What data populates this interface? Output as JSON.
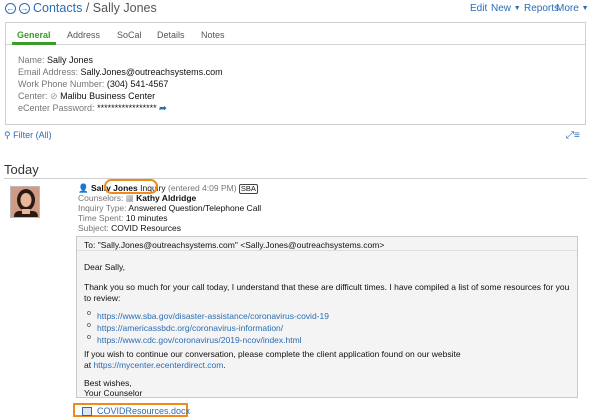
{
  "header": {
    "breadcrumb_root": "Contacts",
    "breadcrumb_sep": "/",
    "breadcrumb_current": "Sally Jones",
    "menu": {
      "edit": "Edit",
      "new": "New",
      "reports": "Reports",
      "more": "More"
    }
  },
  "tabs": [
    "General",
    "Address",
    "SoCal",
    "Details",
    "Notes"
  ],
  "contact": {
    "name_label": "Name:",
    "name": "Sally Jones",
    "email_label": "Email Address:",
    "email": "Sally.Jones@outreachsystems.com",
    "phone_label": "Work Phone Number:",
    "phone": "(304) 541-4567",
    "center_label": "Center:",
    "center": "Malibu Business Center",
    "password_label": "eCenter Password:",
    "password": "*****************"
  },
  "filter": {
    "label": "Filter (All)"
  },
  "section": {
    "title": "Today"
  },
  "activity": {
    "contact_name": "Sally Jones",
    "type_tag": "Inquiry",
    "entered": "(entered 4:09 PM)",
    "badge": "SBA",
    "counselors_label": "Counselors:",
    "counselor": "Kathy Aldridge",
    "inquiry_type_label": "Inquiry Type:",
    "inquiry_type": "Answered Question/Telephone Call",
    "time_label": "Time Spent:",
    "time": "10 minutes",
    "subject_label": "Subject:",
    "subject": "COVID Resources"
  },
  "email": {
    "to": "To: \"Sally.Jones@outreachsystems.com\" <Sally.Jones@outreachsystems.com>",
    "greeting": "Dear Sally,",
    "body_1": "Thank you so much for your call today, I understand that these are difficult times.  I have compiled a list of some resources for you",
    "body_2": "to review:",
    "links": [
      "https://www.sba.gov/disaster-assistance/coronavirus-covid-19",
      "https://americassbdc.org/coronavirus-information/",
      "https://www.cdc.gov/coronavirus/2019-ncov/index.html"
    ],
    "continue_1": "If you wish to continue our conversation, please complete the client application found on our website",
    "continue_2_prefix": "at ",
    "continue_link": "https://mycenter.ecenterdirect.com",
    "continue_2_suffix": ".",
    "closing_1": "Best wishes,",
    "closing_2": "Your Counselor"
  },
  "attachment": {
    "name": "COVIDResources.docx"
  },
  "colors": {
    "link": "#2a6db5",
    "accent_green": "#3a9c28",
    "highlight": "#f08a1c"
  }
}
